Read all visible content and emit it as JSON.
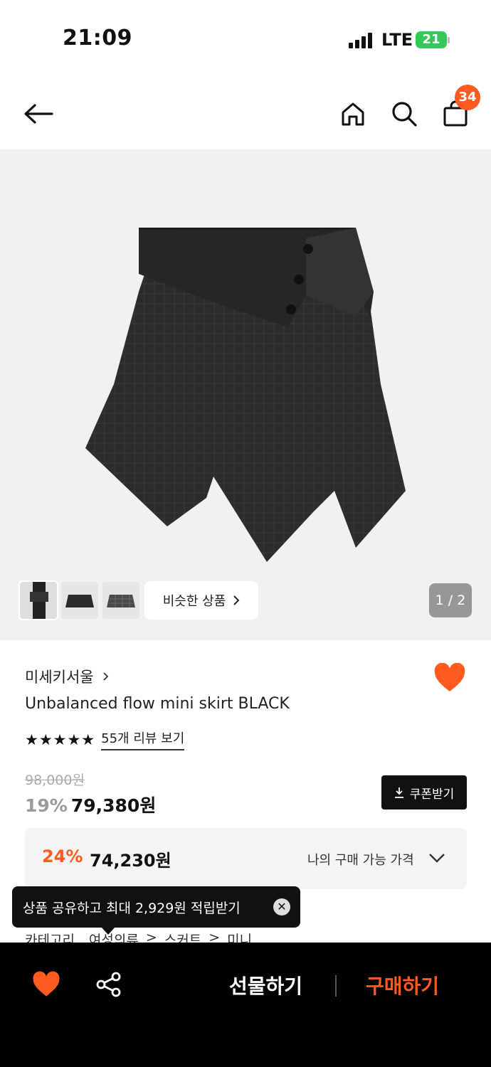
{
  "status_bar": {
    "time": "21:09",
    "network": "LTE",
    "battery": "21"
  },
  "header": {
    "cart_count": "34",
    "icons": [
      "back-arrow-icon",
      "home-icon",
      "search-icon",
      "shopping-bag-icon"
    ]
  },
  "gallery": {
    "similar_label": "비슷한 상품",
    "page_indicator": "1 / 2"
  },
  "product": {
    "brand": "미세키서울",
    "name": "Unbalanced flow mini skirt BLACK",
    "stars": "★★★★★",
    "review_link": "55개 리뷰 보기",
    "original_price": "98,000원",
    "discount_rate": "19%",
    "price": "79,380원",
    "coupon_label": "쿠폰받기"
  },
  "my_price": {
    "discount_rate": "24%",
    "price": "74,230원",
    "label": "나의 구매 가능 가격"
  },
  "category": {
    "label": "카테고리",
    "path": [
      "여성의류",
      ">",
      "스커트",
      ">",
      "미니"
    ]
  },
  "tooltip": {
    "text": "상품 공유하고 최대 2,929원 적립받기",
    "close": "✕"
  },
  "bottom_bar": {
    "gift_label": "선물하기",
    "buy_label": "구매하기"
  },
  "colors": {
    "accent": "#ff5a1f",
    "dark": "#111111",
    "battery": "#34c759"
  }
}
